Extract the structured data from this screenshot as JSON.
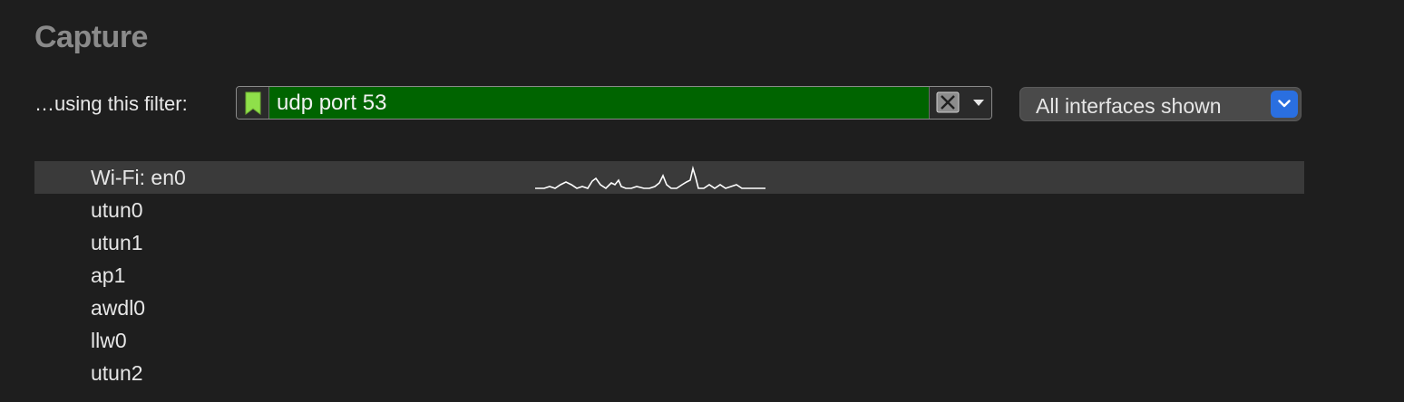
{
  "section": {
    "title": "Capture"
  },
  "filter": {
    "label": "…using this filter:",
    "value": "udp port 53",
    "valid_color": "#006400",
    "bookmark_color": "#8fe04a"
  },
  "interfaces_selector": {
    "label": "All interfaces shown",
    "accent": "#2a6fe0"
  },
  "interfaces": [
    {
      "name": "Wi-Fi: en0",
      "selected": true,
      "has_traffic": true
    },
    {
      "name": "utun0",
      "selected": false,
      "has_traffic": false
    },
    {
      "name": "utun1",
      "selected": false,
      "has_traffic": false
    },
    {
      "name": "ap1",
      "selected": false,
      "has_traffic": false
    },
    {
      "name": "awdl0",
      "selected": false,
      "has_traffic": false
    },
    {
      "name": "llw0",
      "selected": false,
      "has_traffic": false
    },
    {
      "name": "utun2",
      "selected": false,
      "has_traffic": false
    }
  ],
  "icons": {
    "bookmark": "bookmark-icon",
    "clear": "clear-x-icon",
    "dropdown": "caret-down-icon",
    "selector_arrow": "chevron-down-icon"
  }
}
